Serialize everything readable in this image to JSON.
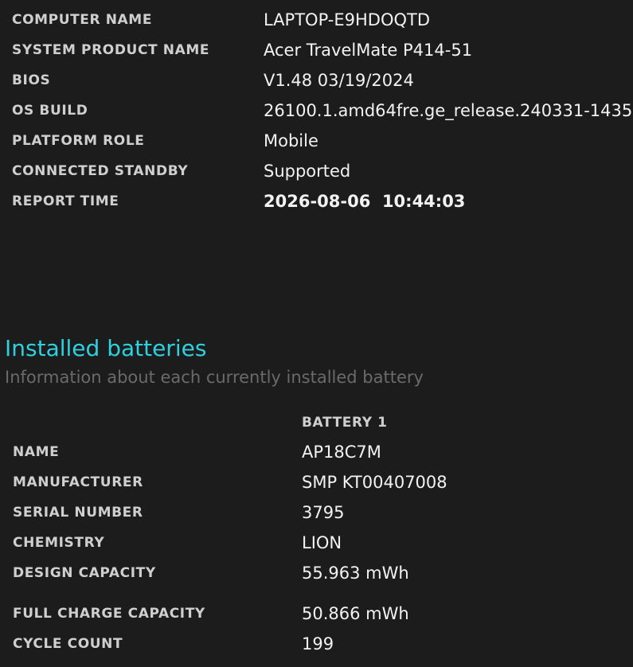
{
  "system_info": [
    {
      "label": "COMPUTER NAME",
      "value": "LAPTOP-E9HDOQTD"
    },
    {
      "label": "SYSTEM PRODUCT NAME",
      "value": "Acer TravelMate P414-51"
    },
    {
      "label": "BIOS",
      "value": "V1.48 03/19/2024"
    },
    {
      "label": "OS BUILD",
      "value": "26100.1.amd64fre.ge_release.240331-1435"
    },
    {
      "label": "PLATFORM ROLE",
      "value": "Mobile"
    },
    {
      "label": "CONNECTED STANDBY",
      "value": "Supported"
    },
    {
      "label": "REPORT TIME",
      "value": "2026-08-06  10:44:03"
    }
  ],
  "batteries_section": {
    "title": "Installed batteries",
    "subtitle": "Information about each currently installed battery",
    "column_header": "BATTERY 1",
    "rows": [
      {
        "label": "NAME",
        "value": "AP18C7M"
      },
      {
        "label": "MANUFACTURER",
        "value": "SMP KT00407008"
      },
      {
        "label": "SERIAL NUMBER",
        "value": "3795"
      },
      {
        "label": "CHEMISTRY",
        "value": "LION"
      },
      {
        "label": "DESIGN CAPACITY",
        "value": "55.963 mWh"
      },
      {
        "label": "FULL CHARGE CAPACITY",
        "value": "50.866 mWh"
      },
      {
        "label": "CYCLE COUNT",
        "value": "199"
      }
    ]
  },
  "colors": {
    "background": "#1c1c1c",
    "section_title": "#2fd0e0",
    "label": "#cfcfcf",
    "value": "#f2f2f2",
    "subtitle": "#6a6a6a"
  }
}
